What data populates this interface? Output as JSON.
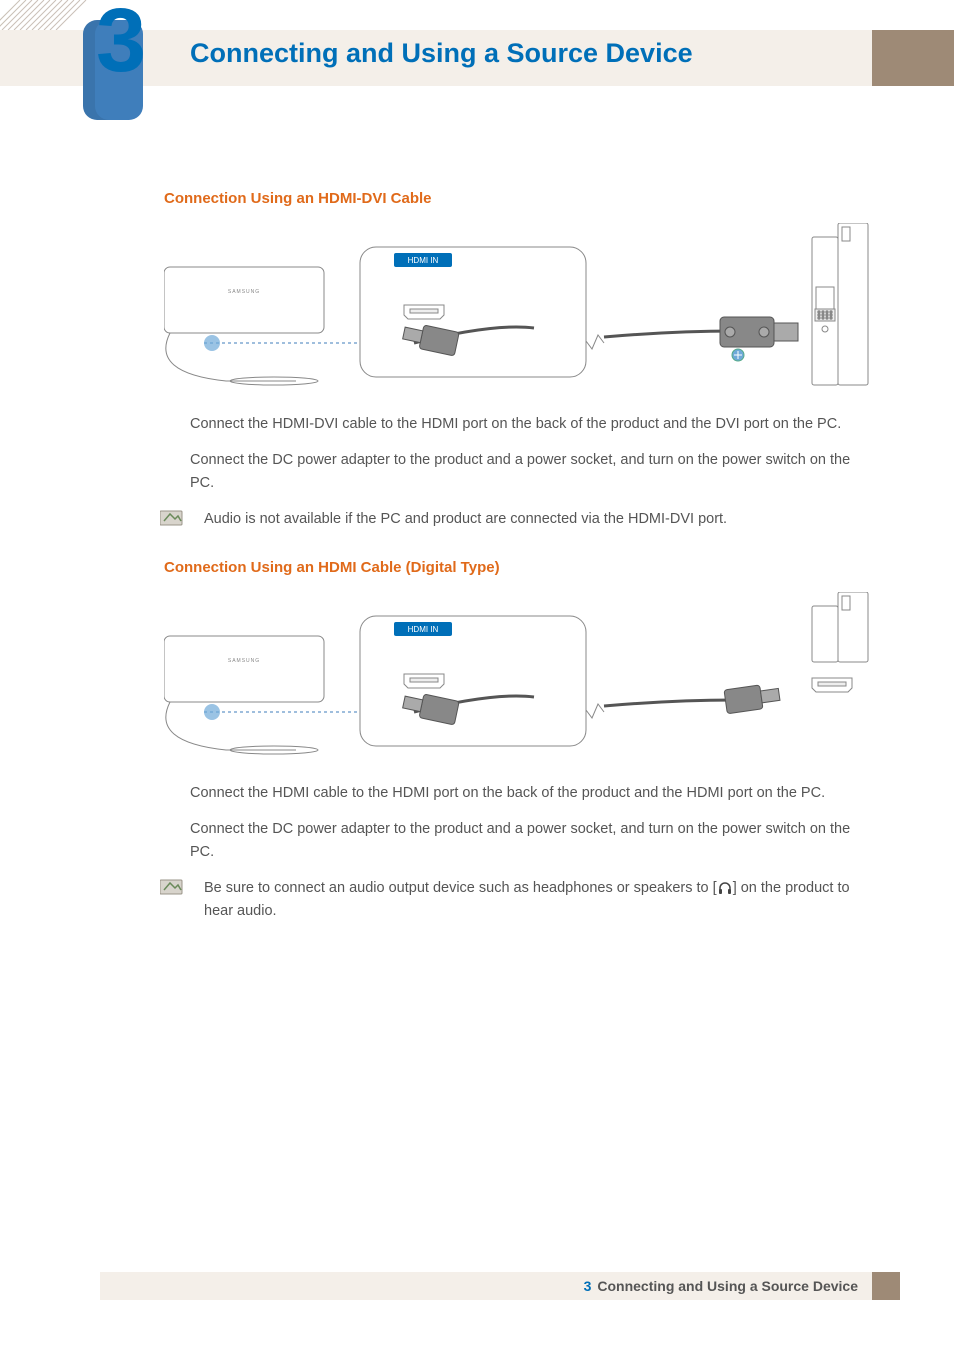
{
  "chapter": {
    "number": "3",
    "title": "Connecting and Using a Source Device"
  },
  "section1": {
    "heading": "Connection Using an HDMI-DVI Cable",
    "port_label": "HDMI IN",
    "step1": "Connect the HDMI-DVI cable to the HDMI port on the back of the product and the DVI port on the PC.",
    "step2": "Connect the DC power adapter to the product and a power socket, and turn on the power switch on the PC.",
    "note": "Audio is not available if the PC and product are connected via the HDMI-DVI port."
  },
  "section2": {
    "heading": "Connection Using an HDMI Cable (Digital Type)",
    "port_label": "HDMI IN",
    "step1": "Connect the HDMI cable to the HDMI port on the back of the product and the HDMI port on the PC.",
    "step2": "Connect the DC power adapter to the product and a power socket, and turn on the power switch on the PC.",
    "note_a": "Be sure to connect an audio output device such as headphones or speakers to [",
    "note_b": "] on the product to hear audio."
  },
  "footer": {
    "number": "3",
    "title": "Connecting and Using a Source Device"
  }
}
